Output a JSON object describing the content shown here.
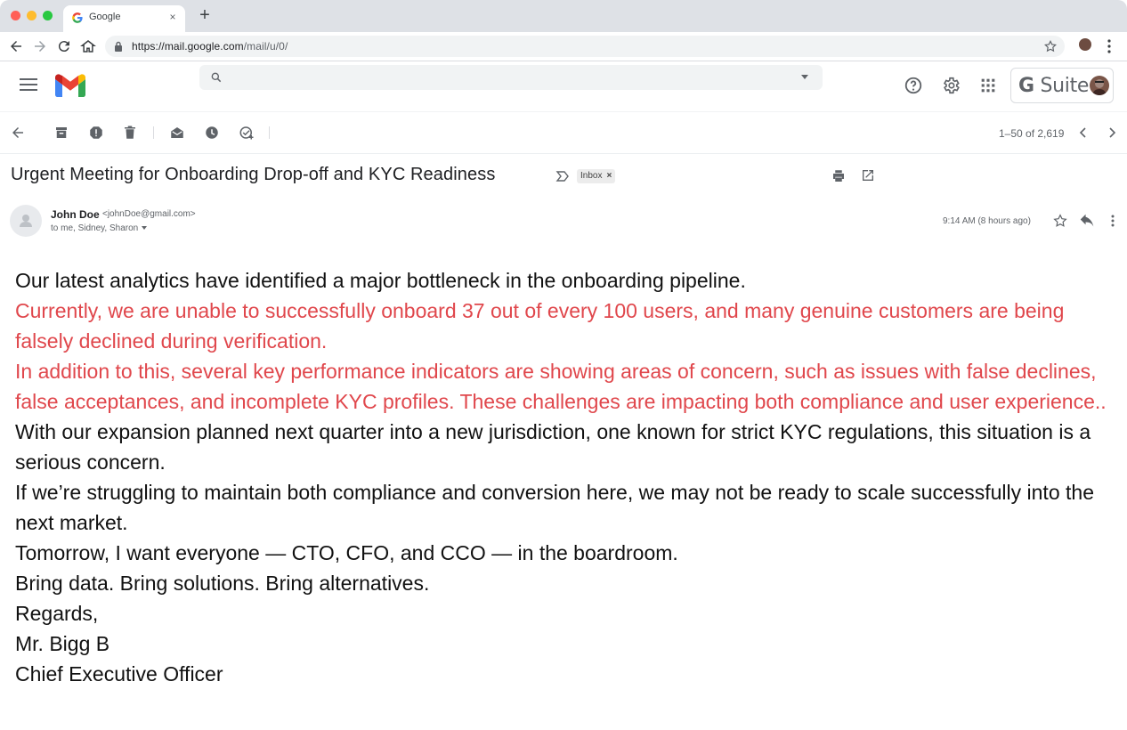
{
  "browser": {
    "tab": {
      "title": "Google",
      "close_glyph": "×"
    },
    "new_tab_glyph": "+",
    "url": {
      "host": "https://mail.google.com",
      "path": "/mail/u/0/"
    }
  },
  "gmail": {
    "search": {
      "value": "",
      "placeholder": ""
    },
    "gsuite_label": "Suite",
    "gsuite_g": "G",
    "pager": "1–50 of 2,619"
  },
  "email": {
    "subject": "Urgent Meeting for Onboarding Drop-off and KYC Readiness",
    "label": "Inbox",
    "label_close": "×",
    "sender_name": "John Doe",
    "sender_email": "<johnDoe@gmail.com>",
    "recipients": "to me, Sidney, Sharon",
    "time": "9:14 AM  (8 hours ago)",
    "body": {
      "p1": "Our latest analytics have identified a major bottleneck in the onboarding pipeline.",
      "p2": "Currently, we are unable to successfully onboard 37 out of every 100 users, and many genuine customers are being falsely declined during verification.",
      "p3": "In addition to this, several key performance indicators are showing areas of concern, such as issues with false declines, false acceptances, and incomplete KYC profiles. These challenges are impacting both compliance and user experience..",
      "p4": "With our expansion planned next quarter into a new jurisdiction, one known for strict KYC regulations, this situation is a serious concern.",
      "p5": "If we’re struggling to maintain both compliance and conversion here, we may not be ready to scale successfully into the next market.",
      "p6": "Tomorrow, I want everyone — CTO, CFO, and CCO — in the boardroom.",
      "p7": "Bring data. Bring solutions. Bring alternatives.",
      "p8": "Regards,",
      "p9": "Mr. Bigg B",
      "p10": "Chief Executive Officer"
    }
  },
  "colors": {
    "alert_text": "#e0474c",
    "body_text": "#111111"
  },
  "icons": {
    "browser": [
      "back-icon",
      "forward-icon",
      "reload-icon",
      "home-icon",
      "lock-icon",
      "star-icon",
      "more-vert-icon"
    ],
    "gmail_header": [
      "menu-icon",
      "gmail-logo",
      "search-icon",
      "help-icon",
      "gear-icon",
      "apps-icon"
    ],
    "mail_toolbar": [
      "back-arrow-icon",
      "archive-icon",
      "report-spam-icon",
      "delete-icon",
      "mark-unread-icon",
      "snooze-icon",
      "add-task-icon",
      "chevron-left-icon",
      "chevron-right-icon"
    ],
    "message": [
      "important-icon",
      "print-icon",
      "open-new-window-icon",
      "star-icon",
      "reply-icon",
      "more-vert-icon"
    ]
  }
}
